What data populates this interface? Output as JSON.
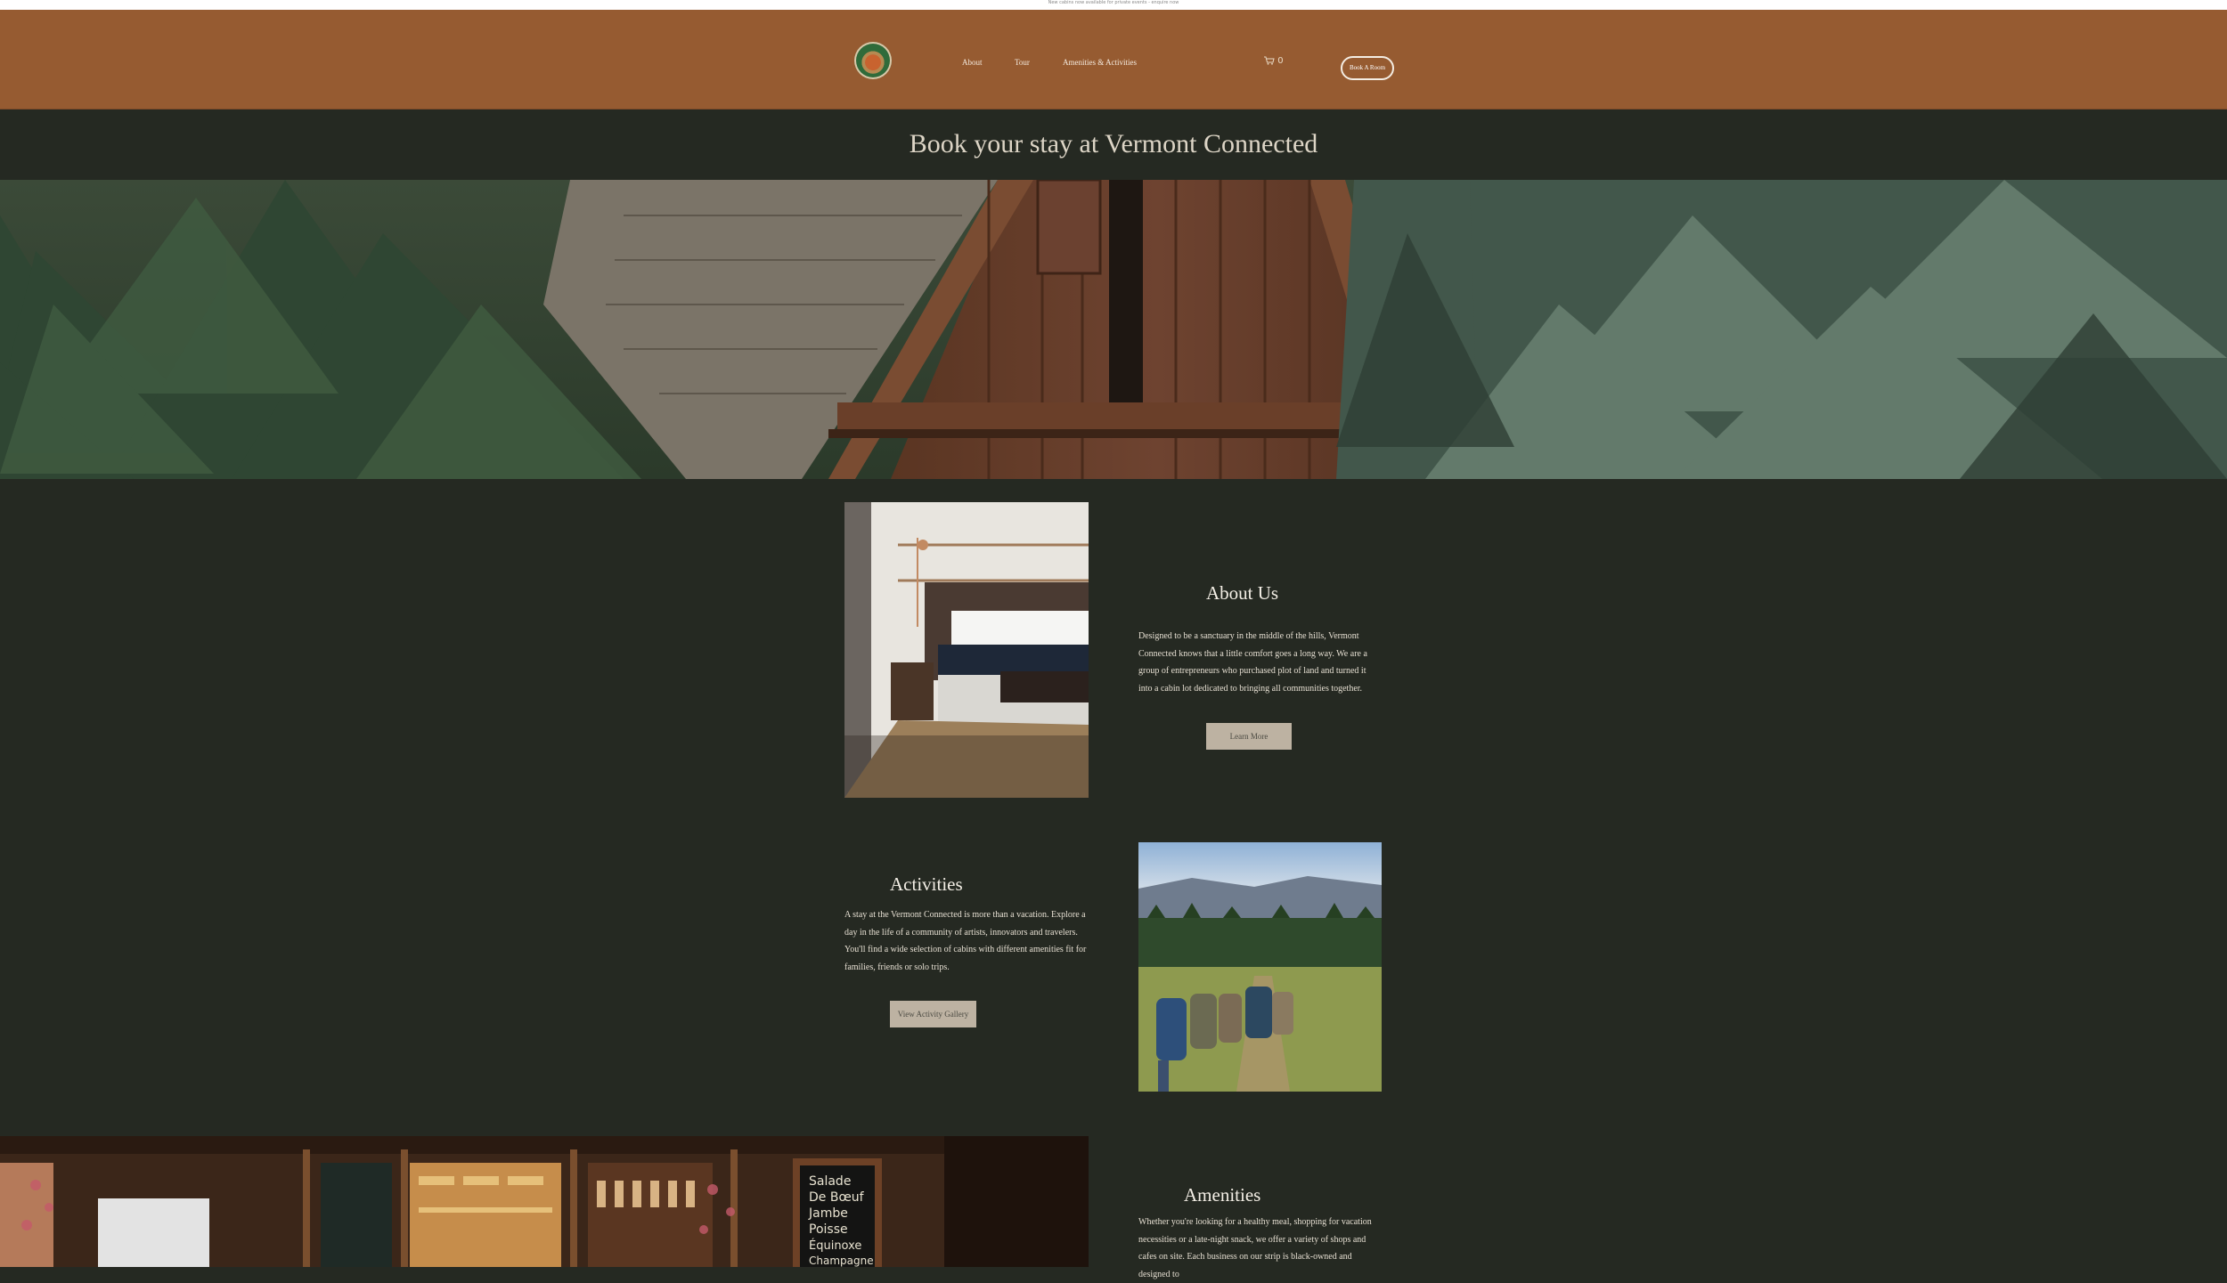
{
  "announcement": "New cabins now available for private events - enquire now",
  "header": {
    "nav": [
      {
        "label": "About"
      },
      {
        "label": "Tour"
      },
      {
        "label": "Amenities & Activities"
      }
    ],
    "cart_count": "0",
    "book_button": "Book A Room"
  },
  "page_title": "Book your stay at Vermont Connected",
  "about": {
    "title": "About Us",
    "text": "Designed to be a sanctuary in the middle of the hills, Vermont Connected  knows that a little comfort goes a long way. We are a group of entrepreneurs who purchased plot of land and turned it into a cabin lot dedicated to bringing all communities together.",
    "button": "Learn More"
  },
  "activities": {
    "title": "Activities",
    "text": "A stay at the Vermont Connected is more than a vacation. Explore a day in the life of a community of artists, innovators and travelers. You'll find a wide selection of cabins with different amenities fit for families, friends or solo trips.",
    "button": "View Activity Gallery"
  },
  "amenities": {
    "title": "Amenities",
    "text": "Whether you're looking for a healthy meal, shopping for vacation necessities or a late-night snack, we offer a variety of shops and cafes on site. Each business on our strip is black-owned and designed to"
  },
  "chalkboard_text": "Salade De Bœuf Jambe Poisse Équinoxe Champagne",
  "colors": {
    "header": "#965b31",
    "background": "#252922",
    "button": "#bdb2a2",
    "title_text": "#ddd5c6"
  }
}
